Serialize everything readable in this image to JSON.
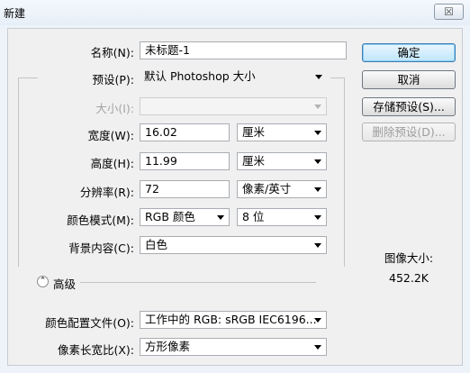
{
  "window": {
    "title": "新建",
    "close_glyph": "☒"
  },
  "fields": {
    "name": {
      "label": "名称(N):",
      "value": "未标题-1"
    },
    "preset": {
      "label": "预设(P):",
      "value": "默认 Photoshop 大小"
    },
    "size": {
      "label": "大小(I):",
      "value": ""
    },
    "width": {
      "label": "宽度(W):",
      "value": "16.02",
      "unit": "厘米"
    },
    "height": {
      "label": "高度(H):",
      "value": "11.99",
      "unit": "厘米"
    },
    "resolution": {
      "label": "分辨率(R):",
      "value": "72",
      "unit": "像素/英寸"
    },
    "color_mode": {
      "label": "颜色模式(M):",
      "value": "RGB 颜色",
      "bits": "8 位"
    },
    "background": {
      "label": "背景内容(C):",
      "value": "白色"
    },
    "advanced": {
      "label": "高级",
      "toggle_glyph": "⌃"
    },
    "color_profile": {
      "label": "颜色配置文件(O):",
      "value": "工作中的 RGB: sRGB IEC6196..."
    },
    "pixel_aspect": {
      "label": "像素长宽比(X):",
      "value": "方形像素"
    }
  },
  "buttons": {
    "ok": "确定",
    "cancel": "取消",
    "save_preset": "存储预设(S)...",
    "delete_preset": "删除预设(D)..."
  },
  "image_size": {
    "label": "图像大小:",
    "value": "452.2K"
  }
}
